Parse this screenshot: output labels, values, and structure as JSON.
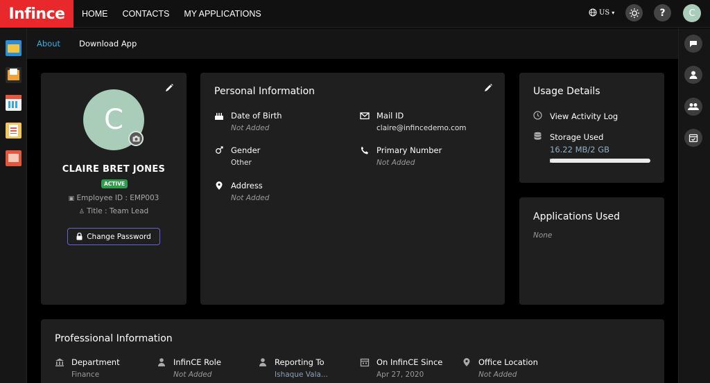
{
  "app": {
    "logo": "Infince"
  },
  "nav": {
    "home": "HOME",
    "contacts": "CONTACTS",
    "my_applications": "MY APPLICATIONS"
  },
  "topright": {
    "language": "US",
    "help": "?",
    "avatar_initial": "C"
  },
  "subtabs": {
    "about": "About",
    "download": "Download App"
  },
  "profile": {
    "initial": "C",
    "name": "CLAIRE BRET JONES",
    "status": "ACTIVE",
    "employee_id": "Employee ID : EMP003",
    "title": "Title : Team Lead",
    "change_password": "Change Password"
  },
  "personal": {
    "title": "Personal Information",
    "dob_label": "Date of Birth",
    "dob_value": "Not Added",
    "mail_label": "Mail ID",
    "mail_value": "claire@infincedemo.com",
    "gender_label": "Gender",
    "gender_value": "Other",
    "phone_label": "Primary Number",
    "phone_value": "Not Added",
    "address_label": "Address",
    "address_value": "Not Added"
  },
  "usage": {
    "title": "Usage Details",
    "activity": "View Activity Log",
    "storage_label": "Storage Used",
    "storage_value": "16.22 MB/2 GB",
    "storage_fraction": 0.0079
  },
  "apps_used": {
    "title": "Applications Used",
    "value": "None"
  },
  "professional": {
    "title": "Professional Information",
    "department_label": "Department",
    "department_value": "Finance",
    "role_label": "InfinCE Role",
    "role_value": "Not Added",
    "reporting_label": "Reporting To",
    "reporting_value": "Ishaque Vala...",
    "since_label": "On InfinCE Since",
    "since_value": "Apr 27, 2020",
    "office_label": "Office Location",
    "office_value": "Not Added"
  },
  "colors": {
    "brand": "#e8282b",
    "accent": "#33aee2",
    "active": "#2d9e4a",
    "button_border": "#6a5fd6"
  }
}
